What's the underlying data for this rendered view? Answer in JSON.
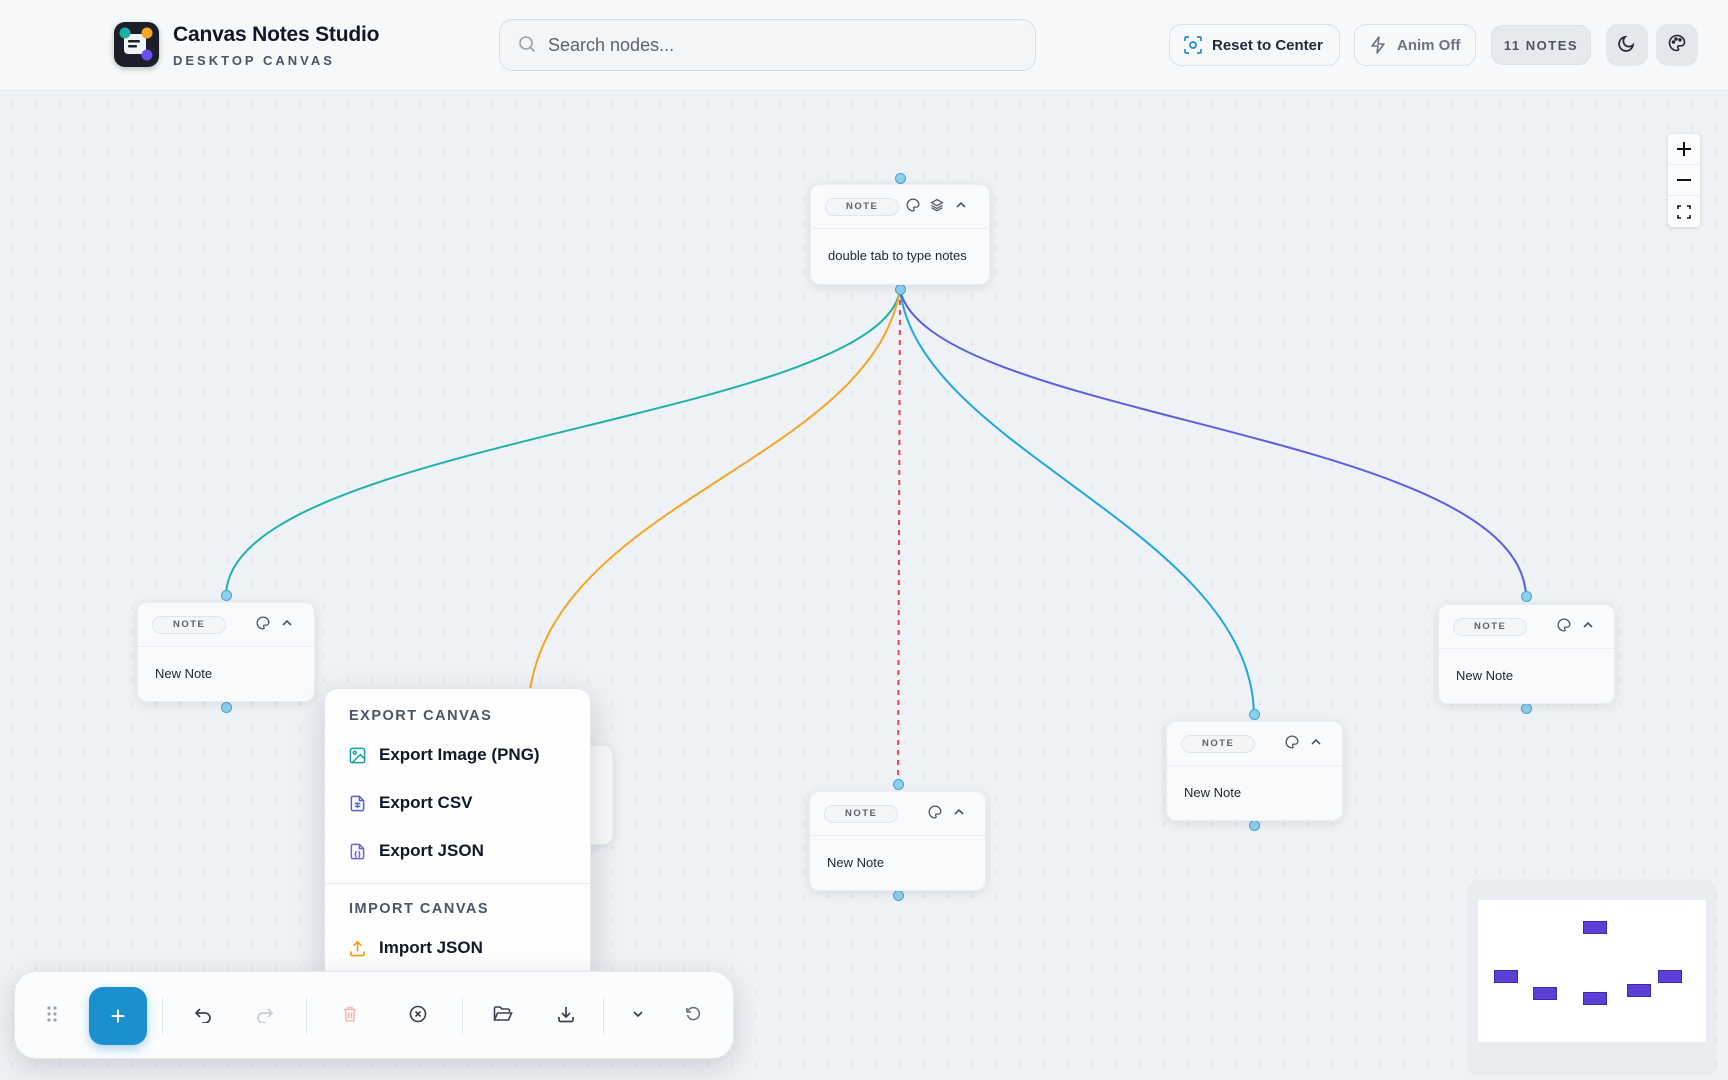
{
  "header": {
    "app_title": "Canvas Notes Studio",
    "app_subtitle": "DESKTOP CANVAS",
    "search_placeholder": "Search nodes...",
    "reset_label": "Reset to Center",
    "anim_label": "Anim Off",
    "notes_count": "11 NOTES",
    "icons": {
      "search": "search-icon",
      "reset": "focus-icon",
      "anim": "lightning-icon",
      "theme": "moon-icon",
      "palette": "palette-icon"
    }
  },
  "nodes": [
    {
      "tag": "NOTE",
      "text": "double tab to type notes"
    },
    {
      "tag": "NOTE",
      "text": "New Note"
    },
    {
      "tag": "NOTE",
      "text": "New Note"
    },
    {
      "tag": "NOTE",
      "text": "New Note"
    },
    {
      "tag": "NOTE",
      "text": "New Note"
    }
  ],
  "edges": {
    "colors": {
      "teal": "#1fb3a8",
      "orange": "#f5a524",
      "red_dashed": "#ef4444",
      "blue": "#1ea7dc",
      "indigo": "#5b5fe0"
    }
  },
  "zoom": [
    "+",
    "−",
    "fit-screen-icon"
  ],
  "export_menu": {
    "export_heading": "EXPORT CANVAS",
    "export_png": "Export Image (PNG)",
    "export_csv": "Export CSV",
    "export_json": "Export JSON",
    "import_heading": "IMPORT CANVAS",
    "import_json": "Import JSON"
  },
  "toolbar": {
    "add_label": "+",
    "items": [
      "drag-handle-icon",
      "undo-icon",
      "redo-icon",
      "trash-icon",
      "clear-icon",
      "folder-open-icon",
      "download-icon",
      "chevron-down-icon",
      "reset-icon"
    ]
  },
  "colors": {
    "accent": "#1c8fd0",
    "minimap_node": "#5b3fd6",
    "handle": "#3da7d6"
  }
}
